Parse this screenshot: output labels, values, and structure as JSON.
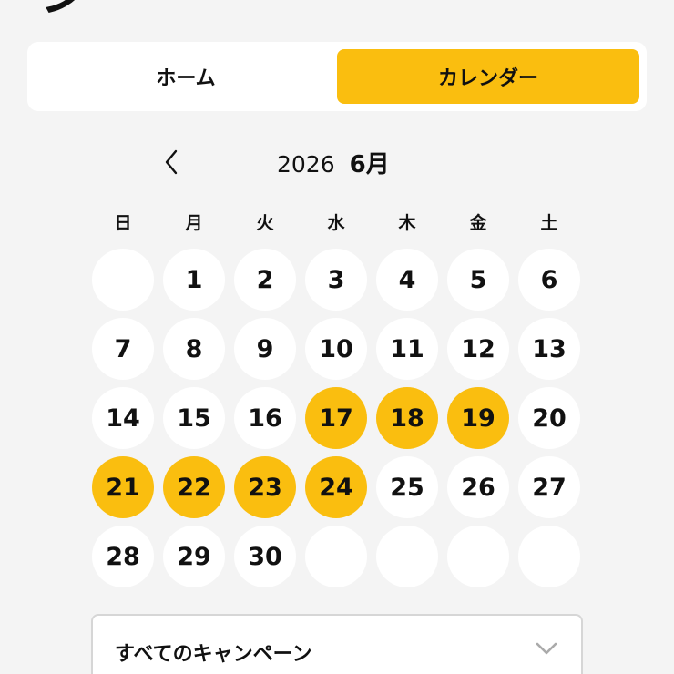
{
  "header": {
    "cut_title": "ジ"
  },
  "tabs": [
    {
      "label": "ホーム",
      "active": false
    },
    {
      "label": "カレンダー",
      "active": true
    }
  ],
  "calendar": {
    "year": "2026",
    "month": "6月",
    "weekdays": [
      "日",
      "月",
      "火",
      "水",
      "木",
      "金",
      "土"
    ],
    "leading_blanks": 1,
    "trailing_blanks": 4,
    "days": [
      {
        "label": "1",
        "highlighted": false
      },
      {
        "label": "2",
        "highlighted": false
      },
      {
        "label": "3",
        "highlighted": false
      },
      {
        "label": "4",
        "highlighted": false
      },
      {
        "label": "5",
        "highlighted": false
      },
      {
        "label": "6",
        "highlighted": false
      },
      {
        "label": "7",
        "highlighted": false
      },
      {
        "label": "8",
        "highlighted": false
      },
      {
        "label": "9",
        "highlighted": false
      },
      {
        "label": "10",
        "highlighted": false
      },
      {
        "label": "11",
        "highlighted": false
      },
      {
        "label": "12",
        "highlighted": false
      },
      {
        "label": "13",
        "highlighted": false
      },
      {
        "label": "14",
        "highlighted": false
      },
      {
        "label": "15",
        "highlighted": false
      },
      {
        "label": "16",
        "highlighted": false
      },
      {
        "label": "17",
        "highlighted": true
      },
      {
        "label": "18",
        "highlighted": true
      },
      {
        "label": "19",
        "highlighted": true
      },
      {
        "label": "20",
        "highlighted": false
      },
      {
        "label": "21",
        "highlighted": true
      },
      {
        "label": "22",
        "highlighted": true
      },
      {
        "label": "23",
        "highlighted": true
      },
      {
        "label": "24",
        "highlighted": true
      },
      {
        "label": "25",
        "highlighted": false
      },
      {
        "label": "26",
        "highlighted": false
      },
      {
        "label": "27",
        "highlighted": false
      },
      {
        "label": "28",
        "highlighted": false
      },
      {
        "label": "29",
        "highlighted": false
      },
      {
        "label": "30",
        "highlighted": false
      }
    ]
  },
  "campaign_filter": {
    "selected": "すべてのキャンペーン"
  },
  "icons": {
    "prev": "chevron-left-icon",
    "dropdown": "chevron-down-icon"
  },
  "colors": {
    "accent": "#fabe0f",
    "background": "#f4f4f4",
    "surface": "#ffffff",
    "text": "#111111"
  }
}
